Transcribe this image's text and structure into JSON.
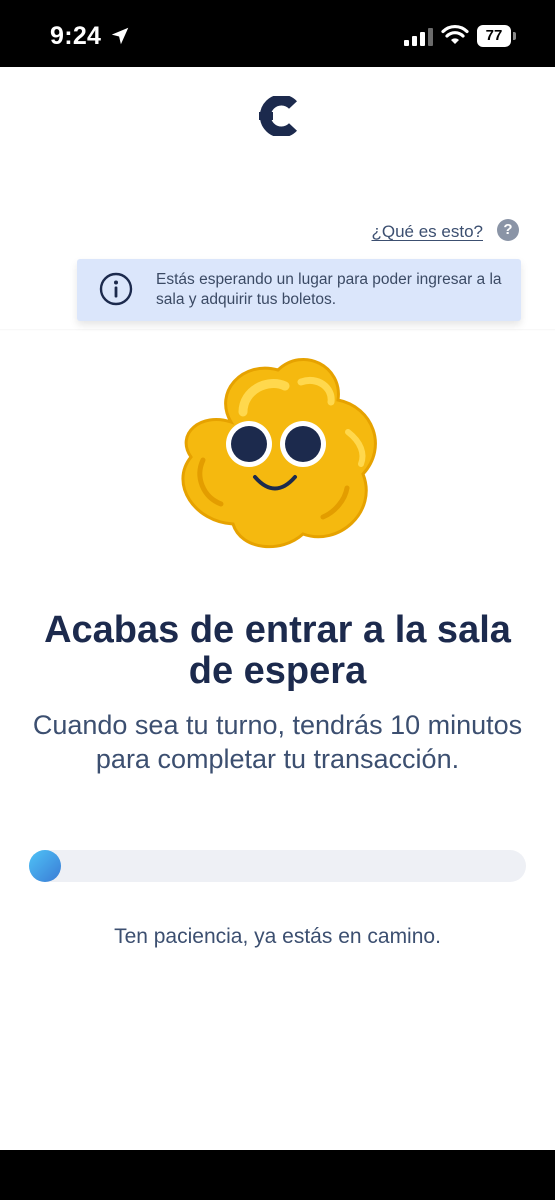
{
  "status_bar": {
    "time": "9:24",
    "battery": "77"
  },
  "help": {
    "link_label": "¿Qué es esto?",
    "icon_label": "?"
  },
  "info_banner": {
    "text": "Estás esperando un lugar para poder ingresar a la sala y adquirir tus boletos."
  },
  "main": {
    "title": "Acabas de entrar a la sala de espera",
    "subtitle": "Cuando sea tu turno, tendrás 10 minutos para completar tu transacción.",
    "progress_fraction": 0.05,
    "patience_text": "Ten paciencia, ya estás en camino."
  },
  "icons": {
    "logo": "brand-logo",
    "location": "location-arrow-icon",
    "signal": "cell-signal-icon",
    "wifi": "wifi-icon",
    "battery": "battery-icon",
    "help": "question-icon",
    "info": "info-icon",
    "mascot": "popcorn-mascot"
  },
  "colors": {
    "brand_navy": "#1c2a4d",
    "text_slate": "#3c4f70",
    "banner_bg": "#dbe6fb",
    "progress_start": "#4fc3f7",
    "progress_end": "#3a7bd5",
    "mascot_yellow": "#f7c21a"
  }
}
